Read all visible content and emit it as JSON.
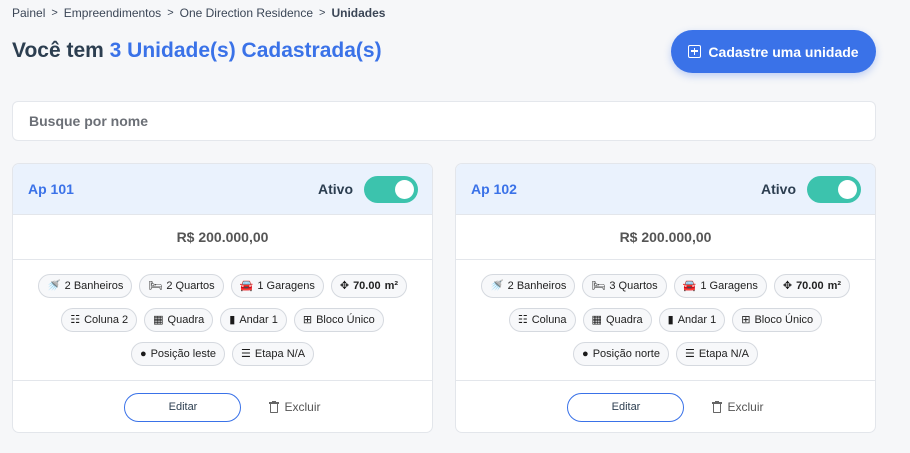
{
  "breadcrumb": {
    "items": [
      "Painel",
      "Empreendimentos",
      "One Direction Residence"
    ],
    "current": "Unidades",
    "separator": ">"
  },
  "header": {
    "title_prefix": "Você tem",
    "title_accent": "3 Unidade(s) Cadastrada(s)",
    "add_button_label": "Cadastre uma unidade",
    "accent_color": "#3a72e8"
  },
  "search": {
    "placeholder": "Busque por nome"
  },
  "units": [
    {
      "name": "Ap 101",
      "status_label": "Ativo",
      "active": true,
      "price": "R$ 200.000,00",
      "chips": {
        "bathrooms": "2 Banheiros",
        "rooms": "2 Quartos",
        "garages": "1 Garagens",
        "area": "70.00",
        "area_unit": "m²",
        "column": "Coluna 2",
        "block_type": "Quadra",
        "floor": "Andar 1",
        "building": "Bloco Único",
        "position": "Posição leste",
        "stage": "Etapa N/A"
      },
      "edit_label": "Editar",
      "delete_label": "Excluir"
    },
    {
      "name": "Ap 102",
      "status_label": "Ativo",
      "active": true,
      "price": "R$ 200.000,00",
      "chips": {
        "bathrooms": "2 Banheiros",
        "rooms": "3 Quartos",
        "garages": "1 Garagens",
        "area": "70.00",
        "area_unit": "m²",
        "column": "Coluna",
        "block_type": "Quadra",
        "floor": "Andar 1",
        "building": "Bloco Único",
        "position": "Posição norte",
        "stage": "Etapa N/A"
      },
      "edit_label": "Editar",
      "delete_label": "Excluir"
    }
  ],
  "colors": {
    "toggle_on": "#3cc3ad",
    "card_header": "#eaf2fd"
  }
}
